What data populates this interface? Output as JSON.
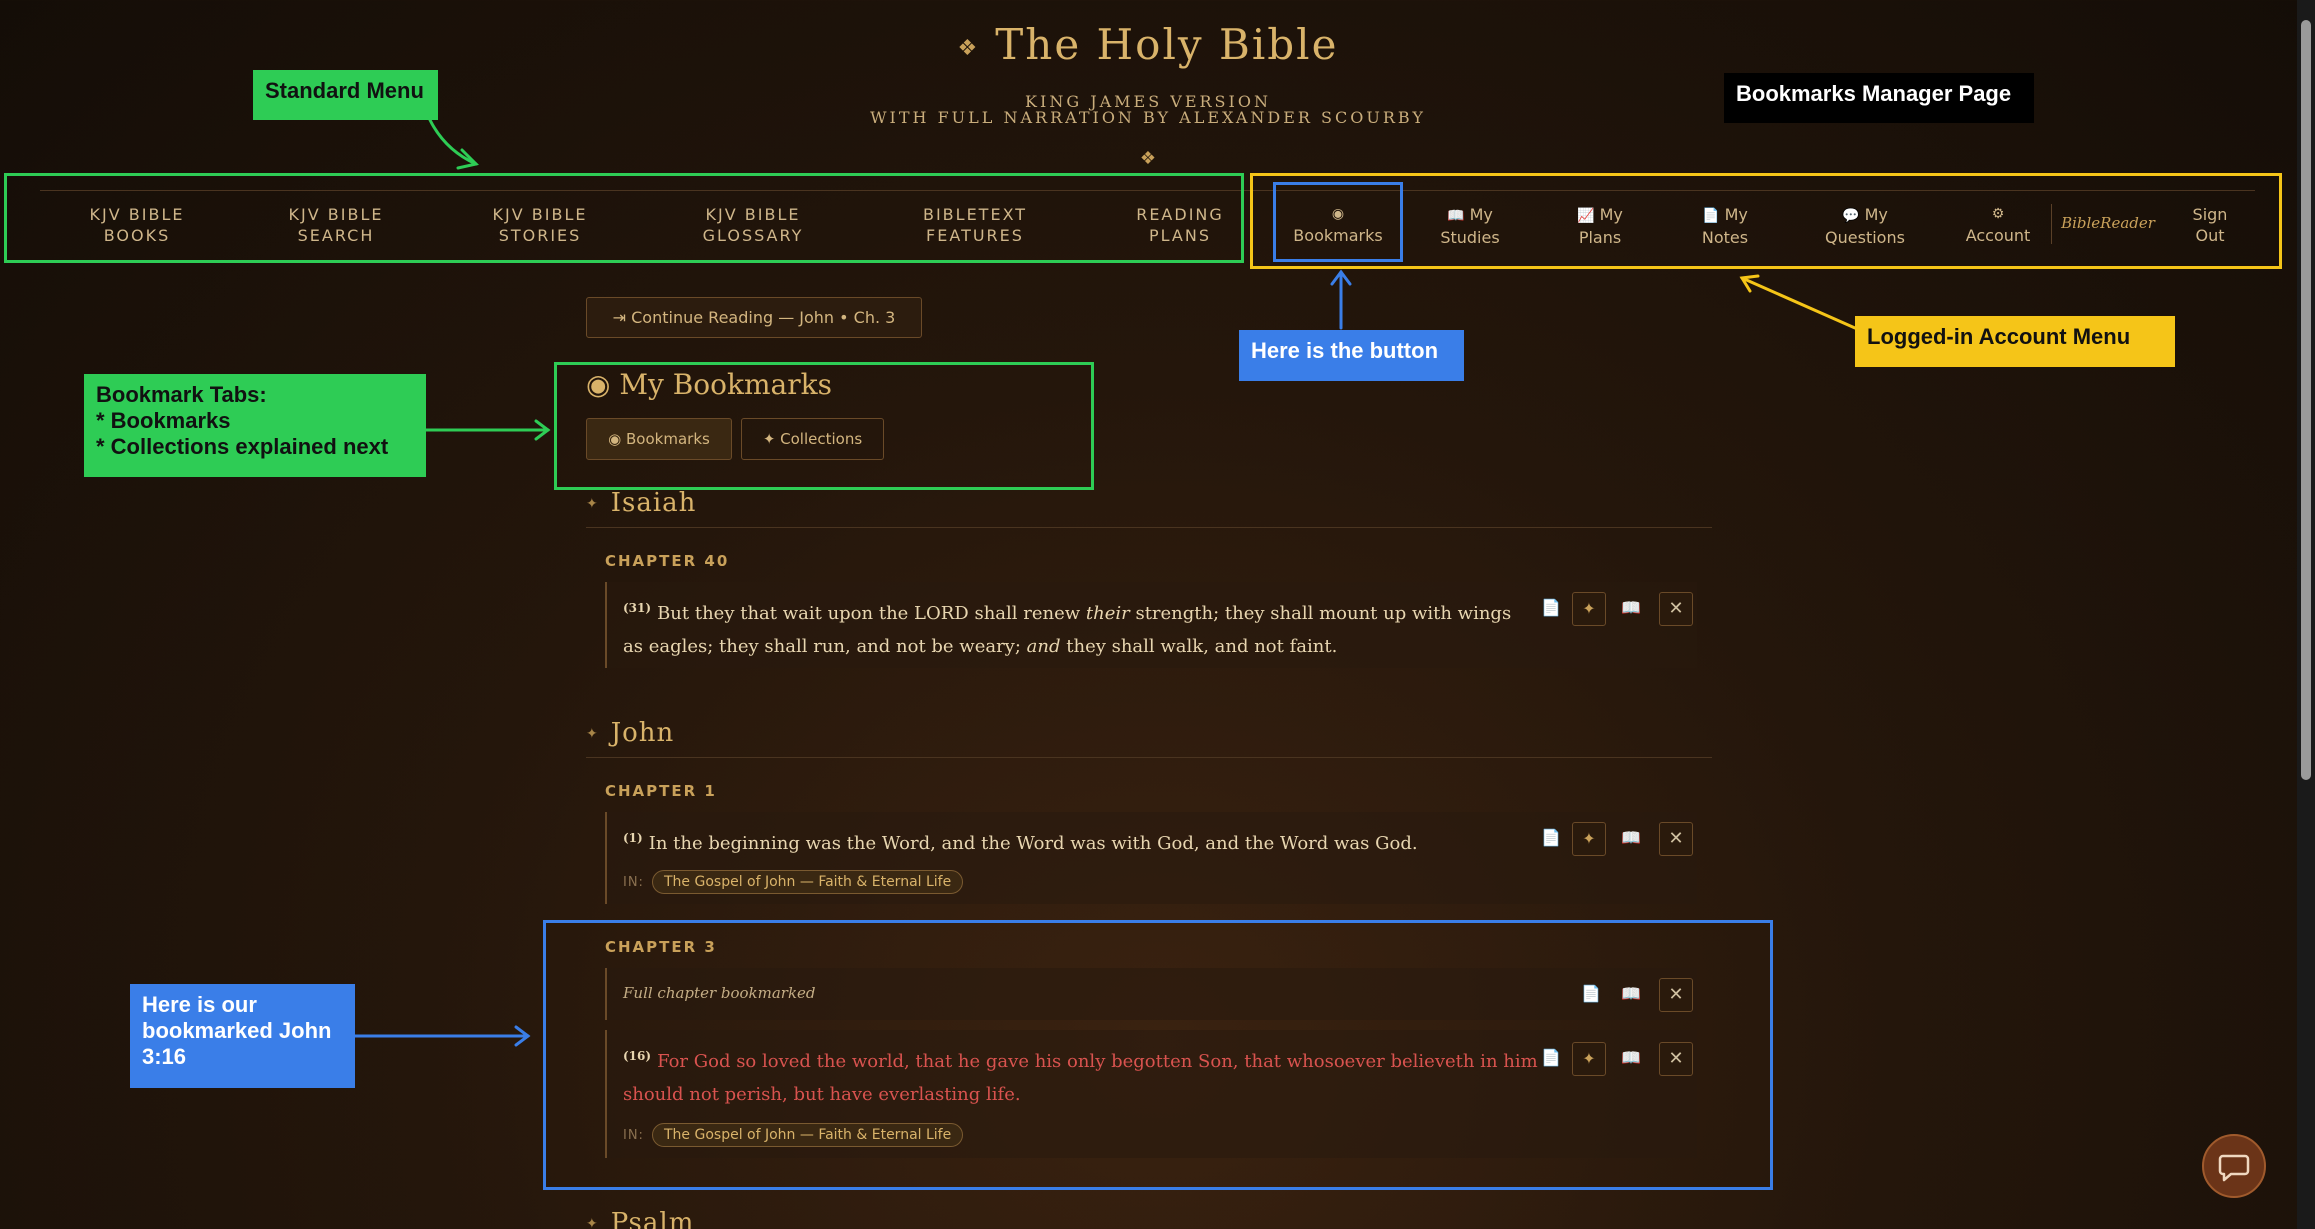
{
  "header": {
    "ornament": "❖",
    "title": "The Holy Bible",
    "subtitle1": "KING JAMES VERSION",
    "subtitle2": "WITH FULL NARRATION BY ALEXANDER SCOURBY",
    "ornament2": "❖"
  },
  "nav": [
    {
      "line1": "KJV BIBLE",
      "line2": "BOOKS"
    },
    {
      "line1": "KJV BIBLE",
      "line2": "SEARCH"
    },
    {
      "line1": "KJV BIBLE",
      "line2": "STORIES"
    },
    {
      "line1": "KJV BIBLE",
      "line2": "GLOSSARY"
    },
    {
      "line1": "BIBLETEXT",
      "line2": "FEATURES"
    },
    {
      "line1": "READING",
      "line2": "PLANS"
    }
  ],
  "account_nav": [
    {
      "icon": "◉",
      "line1": "",
      "line2": "Bookmarks"
    },
    {
      "icon": "📖",
      "line1": "My",
      "line2": "Studies"
    },
    {
      "icon": "📈",
      "line1": "My",
      "line2": "Plans"
    },
    {
      "icon": "📄",
      "line1": "My",
      "line2": "Notes"
    },
    {
      "icon": "💬",
      "line1": "My",
      "line2": "Questions"
    },
    {
      "icon": "⚙",
      "line1": "",
      "line2": "Account"
    }
  ],
  "account_extra": {
    "bible_reader": "BibleReader",
    "signout1": "Sign",
    "signout2": "Out"
  },
  "annotations": {
    "standard_menu": "Standard Menu",
    "page_label": "Bookmarks Manager Page",
    "here_button": "Here is the button",
    "account_menu": "Logged-in Account Menu",
    "tabs_l1": "Bookmark Tabs:",
    "tabs_l2": "* Bookmarks",
    "tabs_l3": "* Collections explained next",
    "john_l1": "Here is our",
    "john_l2": "bookmarked John",
    "john_l3": "3:16"
  },
  "continue_reading": "⇥ Continue Reading — John • Ch. 3",
  "page_title": "◉ My Bookmarks",
  "tabs": {
    "bookmarks": "◉ Bookmarks",
    "collections": "✦ Collections"
  },
  "books": {
    "isaiah": {
      "name": "Isaiah",
      "chapter": "CHAPTER 40",
      "vnum": "(31)",
      "t1": "But they that wait upon the LORD shall renew ",
      "t2": "their",
      "t3": " strength; they shall mount up with wings as",
      "t4": "eagles; they shall run, and not be weary; ",
      "t5": "and",
      "t6": " they shall walk, and not faint."
    },
    "john": {
      "name": "John",
      "ch1": "CHAPTER 1",
      "ch1_vnum": "(1)",
      "ch1_text": "In the beginning was the Word, and the Word was with God, and the Word was God.",
      "in_label": "IN:",
      "collection": "The Gospel of John — Faith & Eternal Life",
      "ch3": "CHAPTER 3",
      "full_chapter": "Full chapter bookmarked",
      "ch3_vnum": "(16)",
      "ch3_line1": "For God so loved the world, that he gave his only begotten Son, that whosoever believeth in him",
      "ch3_line2": "should not perish, but have everlasting life."
    },
    "psalm": {
      "name": "Psalm"
    }
  },
  "icons": {
    "note": "📄",
    "star": "✦",
    "book": "📖",
    "close": "✕",
    "ornament": "✦"
  },
  "colors": {
    "green": "#2ecc55",
    "blue": "#3a7ee8",
    "yellow": "#f5c518",
    "black": "#000000",
    "accent": "#d9b36a",
    "red_text": "#d9534f"
  }
}
